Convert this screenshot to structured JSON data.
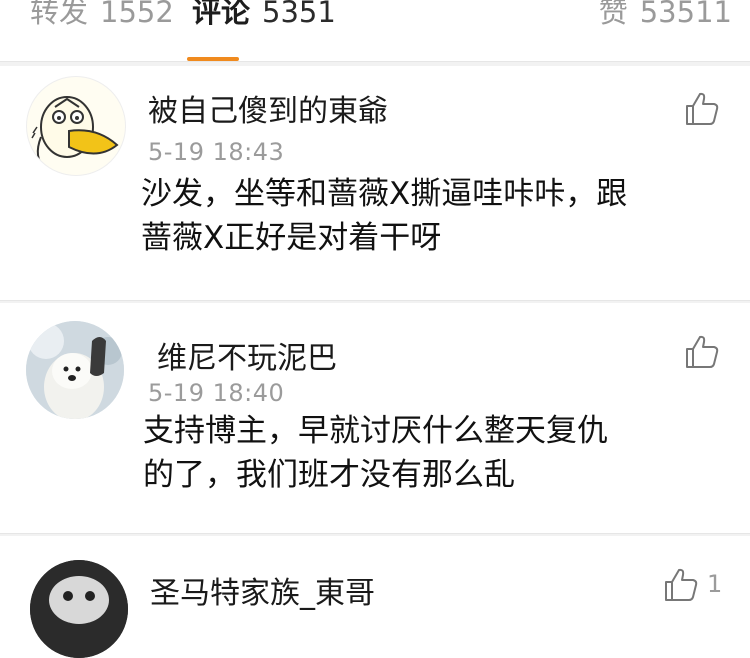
{
  "tabs": {
    "repost": {
      "label": "转发",
      "count": "1552"
    },
    "comment": {
      "label": "评论",
      "count": "5351"
    },
    "like": {
      "label": "赞",
      "count": "53511"
    }
  },
  "colors": {
    "accent": "#f08a1e",
    "muted": "#9b9b9b",
    "text": "#111111"
  },
  "comments": [
    {
      "user": "被自己傻到的東爺",
      "time": "5-19 18:43",
      "text_line1": "沙发，坐等和蔷薇X撕逼哇咔咔，跟",
      "text_line2": "蔷薇X正好是对着干呀",
      "avatar_icon": "cartoon-duck-avatar",
      "like_icon": "thumbs-up-icon"
    },
    {
      "user": "维尼不玩泥巴",
      "time": "5-19 18:40",
      "text_line1": "支持博主，早就讨厌什么整天复仇",
      "text_line2": "的了，我们班才没有那么乱",
      "avatar_icon": "polar-bear-avatar",
      "like_icon": "thumbs-up-icon"
    },
    {
      "user": "圣马特家族_東哥",
      "like_count": "1",
      "avatar_icon": "user-avatar",
      "like_icon": "thumbs-up-icon"
    }
  ]
}
